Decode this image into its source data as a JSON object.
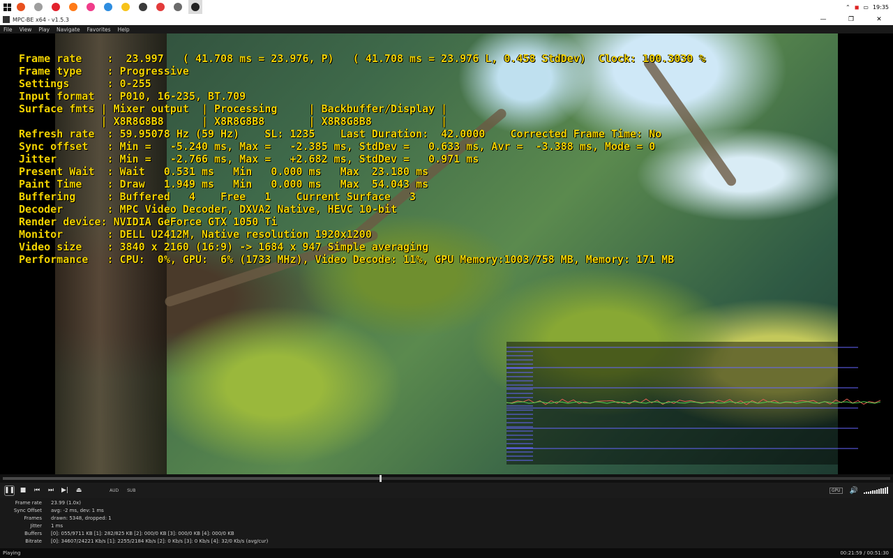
{
  "taskbar": {
    "apps": [
      {
        "name": "search-app",
        "color": "#e8501e"
      },
      {
        "name": "circle-app",
        "color": "#9e9e9e"
      },
      {
        "name": "opera-app",
        "color": "#e2222d"
      },
      {
        "name": "firefox-app",
        "color": "#ff7a17"
      },
      {
        "name": "maxthon-app",
        "color": "#f03c8a"
      },
      {
        "name": "kiwi-app",
        "color": "#2e8de0"
      },
      {
        "name": "chrome-app",
        "color": "#f7c31a"
      },
      {
        "name": "globe-app",
        "color": "#3a3a3a"
      },
      {
        "name": "vivaldi-app",
        "color": "#e33b3b"
      },
      {
        "name": "folder-app",
        "color": "#6b6b6b"
      },
      {
        "name": "mpc-app",
        "color": "#222222"
      }
    ],
    "clock": "19:35"
  },
  "window": {
    "title": "MPC-BE x64 - v1.5.3"
  },
  "menu": [
    "File",
    "View",
    "Play",
    "Navigate",
    "Favorites",
    "Help"
  ],
  "osd_lines": [
    "Frame rate    :  23.997   ( 41.708 ms = 23.976, P)   ( 41.708 ms = 23.976 L, 0.458 StdDev)  Clock: 100.3030 %",
    "Frame type    : Progressive",
    "Settings      : 0-255",
    "Input format  : P010, 16-235, BT.709",
    "Surface fmts | Mixer output  | Processing     | Backbuffer/Display |",
    "             | X8R8G8B8      | X8R8G8B8       | X8R8G8B8           |",
    "Refresh rate  : 59.95078 Hz (59 Hz)    SL: 1235    Last Duration:  42.0000    Corrected Frame Time: No",
    "Sync offset   : Min =   -5.240 ms, Max =   -2.385 ms, StdDev =   0.633 ms, Avr =  -3.388 ms, Mode = 0",
    "Jitter        : Min =   -2.766 ms, Max =   +2.682 ms, StdDev =   0.971 ms",
    "Present Wait  : Wait   0.531 ms   Min   0.000 ms   Max  23.180 ms",
    "Paint Time    : Draw   1.949 ms   Min   0.000 ms   Max  54.043 ms",
    "Buffering     : Buffered   4    Free   1    Current Surface   3",
    "Decoder       : MPC Video Decoder, DXVA2 Native, HEVC 10-bit",
    "Render device: NVIDIA GeForce GTX 1050 Ti",
    "Monitor       : DELL U2412M, Native resolution 1920x1200",
    "Video size    : 3840 x 2160 (16:9) -> 1684 x 947 Simple averaging",
    "Performance   : CPU:  0%, GPU:  6% (1733 MHz), Video Decode: 11%, GPU Memory:1003/758 MB, Memory: 171 MB"
  ],
  "seek": {
    "progress": 0.425
  },
  "controls": {
    "aud": "AUD",
    "sub": "SUB",
    "gpu": "GPU",
    "volume": 1.0
  },
  "stats": [
    {
      "label": "Frame rate",
      "value": "23.99  (1.0x)"
    },
    {
      "label": "Sync Offset",
      "value": "avg: -2 ms, dev: 1 ms"
    },
    {
      "label": "Frames",
      "value": "drawn: 5348, dropped: 1"
    },
    {
      "label": "Jitter",
      "value": "1 ms"
    },
    {
      "label": "Buffers",
      "value": "[0]: 055/9711 KB [1]: 282/825 KB [2]: 000/0 KB [3]: 000/0 KB [4]: 000/0 KB"
    },
    {
      "label": "Bitrate",
      "value": "[0]: 34607/24221 Kb/s [1]: 2255/2184 Kb/s [2]: 0 Kb/s [3]: 0 Kb/s [4]: 32/0 Kb/s (avg/cur)"
    }
  ],
  "status": {
    "state": "Playing",
    "time": "00:21:59 / 00:51:30"
  }
}
